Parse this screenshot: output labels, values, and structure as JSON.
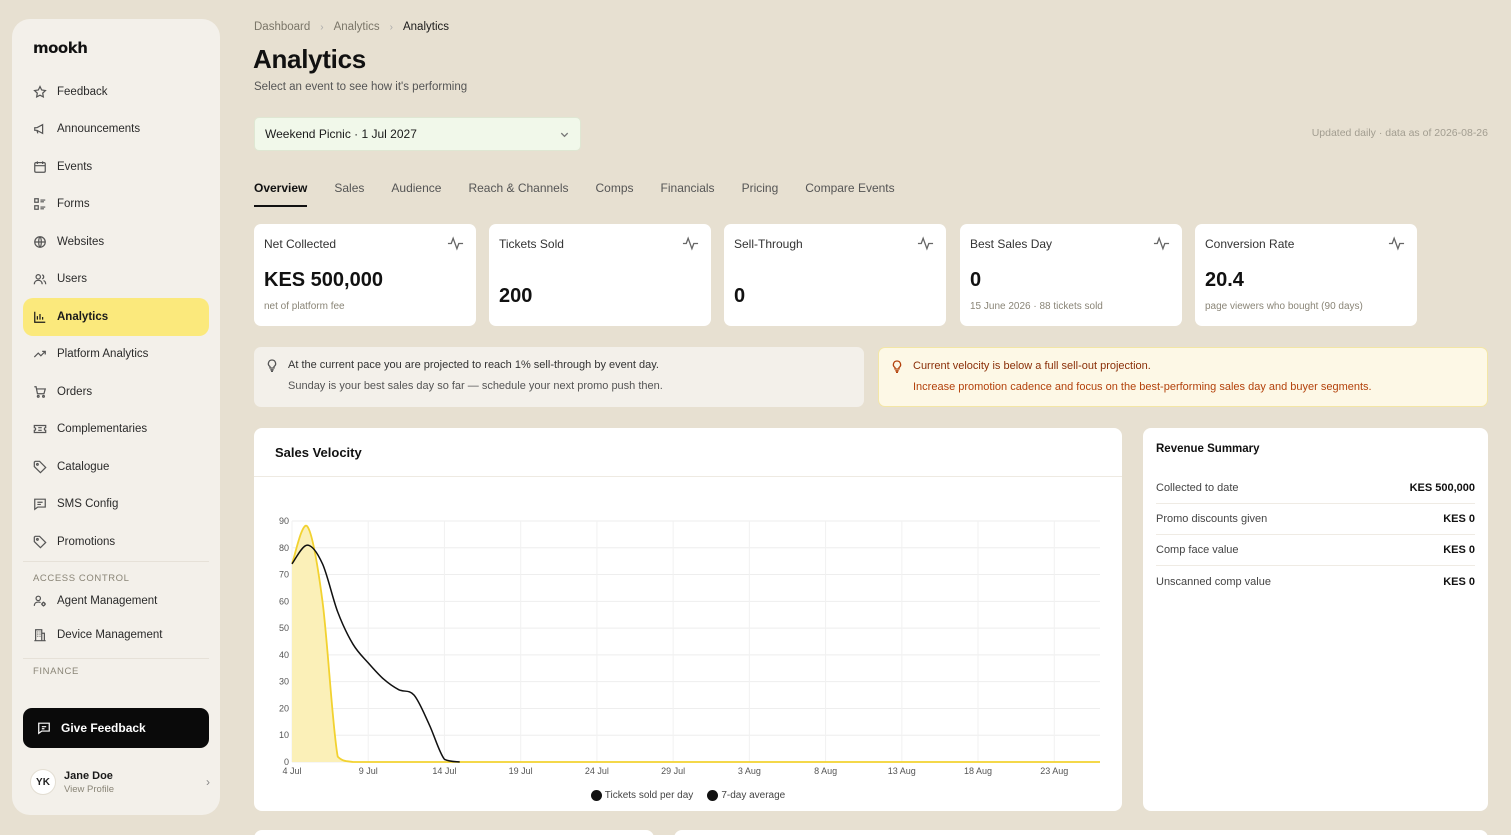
{
  "sidebar": {
    "logo": "mookh",
    "items": [
      {
        "label": "Feedback",
        "icon": "star-icon"
      },
      {
        "label": "Announcements",
        "icon": "megaphone-icon"
      },
      {
        "label": "Events",
        "icon": "calendar-icon"
      },
      {
        "label": "Forms",
        "icon": "form-icon"
      },
      {
        "label": "Websites",
        "icon": "globe-icon"
      },
      {
        "label": "Users",
        "icon": "users-icon"
      },
      {
        "label": "Analytics",
        "icon": "bar-chart-icon",
        "active": true
      },
      {
        "label": "Platform Analytics",
        "icon": "trend-icon"
      },
      {
        "label": "Orders",
        "icon": "cart-icon"
      },
      {
        "label": "Complementaries",
        "icon": "ticket-icon"
      },
      {
        "label": "Catalogue",
        "icon": "tag-icon"
      },
      {
        "label": "SMS Config",
        "icon": "message-icon"
      },
      {
        "label": "Promotions",
        "icon": "tag-icon"
      }
    ],
    "access_control_label": "ACCESS CONTROL",
    "access_items": [
      {
        "label": "Agent Management",
        "icon": "user-cog-icon"
      },
      {
        "label": "Device Management",
        "icon": "building-icon"
      }
    ],
    "finance_label": "FINANCE",
    "feedback_button": "Give Feedback",
    "profile": {
      "initials": "YK",
      "name": "Jane Doe",
      "sub": "View Profile"
    }
  },
  "breadcrumb": [
    "Dashboard",
    "Analytics",
    "Analytics"
  ],
  "page": {
    "title": "Analytics",
    "subtitle": "Select an event to see how it's performing",
    "event_selected": "Weekend Picnic · 1 Jul 2027",
    "updated": "Updated daily · data as of 2026-08-26"
  },
  "tabs": [
    "Overview",
    "Sales",
    "Audience",
    "Reach & Channels",
    "Comps",
    "Financials",
    "Pricing",
    "Compare Events"
  ],
  "kpis": [
    {
      "label": "Net Collected",
      "value": "KES 500,000",
      "sub": "net of platform fee"
    },
    {
      "label": "Tickets Sold",
      "value": "200",
      "sub": ""
    },
    {
      "label": "Sell-Through",
      "value": "0",
      "sub": ""
    },
    {
      "label": "Best Sales Day",
      "value": "0",
      "sub": "15 June 2026 · 88 tickets sold"
    },
    {
      "label": "Conversion Rate",
      "value": "20.4",
      "sub": "page viewers who bought (90 days)"
    }
  ],
  "insights": {
    "neutral": {
      "line1": "At the current pace you are projected to reach 1% sell-through by event day.",
      "line2": "Sunday is your best sales day so far — schedule your next promo push then."
    },
    "warning": {
      "line1": "Current velocity is below a full sell-out projection.",
      "line2": "Increase promotion cadence and focus on the best-performing sales day and buyer segments."
    }
  },
  "chart": {
    "title": "Sales Velocity",
    "legend": [
      "Tickets sold per day",
      "7-day average"
    ]
  },
  "chart_data": {
    "type": "area",
    "x_ticks": [
      "4 Jul",
      "9 Jul",
      "14 Jul",
      "19 Jul",
      "24 Jul",
      "29 Jul",
      "3 Aug",
      "8 Aug",
      "13 Aug",
      "18 Aug",
      "23 Aug"
    ],
    "ylim": [
      0,
      90
    ],
    "y_ticks": [
      0,
      10,
      20,
      30,
      40,
      50,
      60,
      70,
      80,
      90
    ],
    "series": [
      {
        "name": "Tickets sold per day",
        "color": "#f2d230",
        "fill": "#fbf0b8",
        "x": [
          0,
          1,
          2,
          3,
          4,
          5,
          6,
          7,
          8,
          9,
          10,
          11,
          12,
          13,
          14,
          15,
          16,
          17,
          18,
          19,
          20,
          21,
          22,
          23,
          24,
          25,
          26,
          27,
          28,
          29,
          30,
          31,
          32,
          33,
          34,
          35,
          36,
          37,
          38,
          39,
          40,
          41,
          42,
          43,
          44,
          45,
          46,
          47,
          48,
          49,
          50,
          51,
          52,
          53
        ],
        "values": [
          74,
          88,
          60,
          2,
          0,
          0,
          0,
          0,
          0,
          0,
          0,
          0,
          0,
          0,
          0,
          0,
          0,
          0,
          0,
          0,
          0,
          0,
          0,
          0,
          0,
          0,
          0,
          0,
          0,
          0,
          0,
          0,
          0,
          0,
          0,
          0,
          0,
          0,
          0,
          0,
          0,
          0,
          0,
          0,
          0,
          0,
          0,
          0,
          0,
          0,
          0,
          0,
          0,
          0
        ]
      },
      {
        "name": "7-day average",
        "color": "#111111",
        "x": [
          0,
          1,
          2,
          3,
          4,
          5,
          6,
          7,
          8,
          9,
          10,
          11
        ],
        "values": [
          74,
          81,
          74,
          56,
          44,
          37,
          31,
          27,
          25,
          14,
          1,
          0
        ]
      }
    ],
    "grid": true,
    "legend_position": "bottom"
  },
  "revenue": {
    "title": "Revenue Summary",
    "rows": [
      {
        "label": "Collected to date",
        "value": "KES 500,000"
      },
      {
        "label": "Promo discounts given",
        "value": "KES 0"
      },
      {
        "label": "Comp face value",
        "value": "KES 0"
      },
      {
        "label": "Unscanned comp value",
        "value": "KES 0"
      }
    ]
  },
  "colors": {
    "accent": "#fbe97c",
    "background": "#e7e0d1",
    "warning_text": "#b3410b",
    "warning_bg": "#fdf8e6"
  }
}
